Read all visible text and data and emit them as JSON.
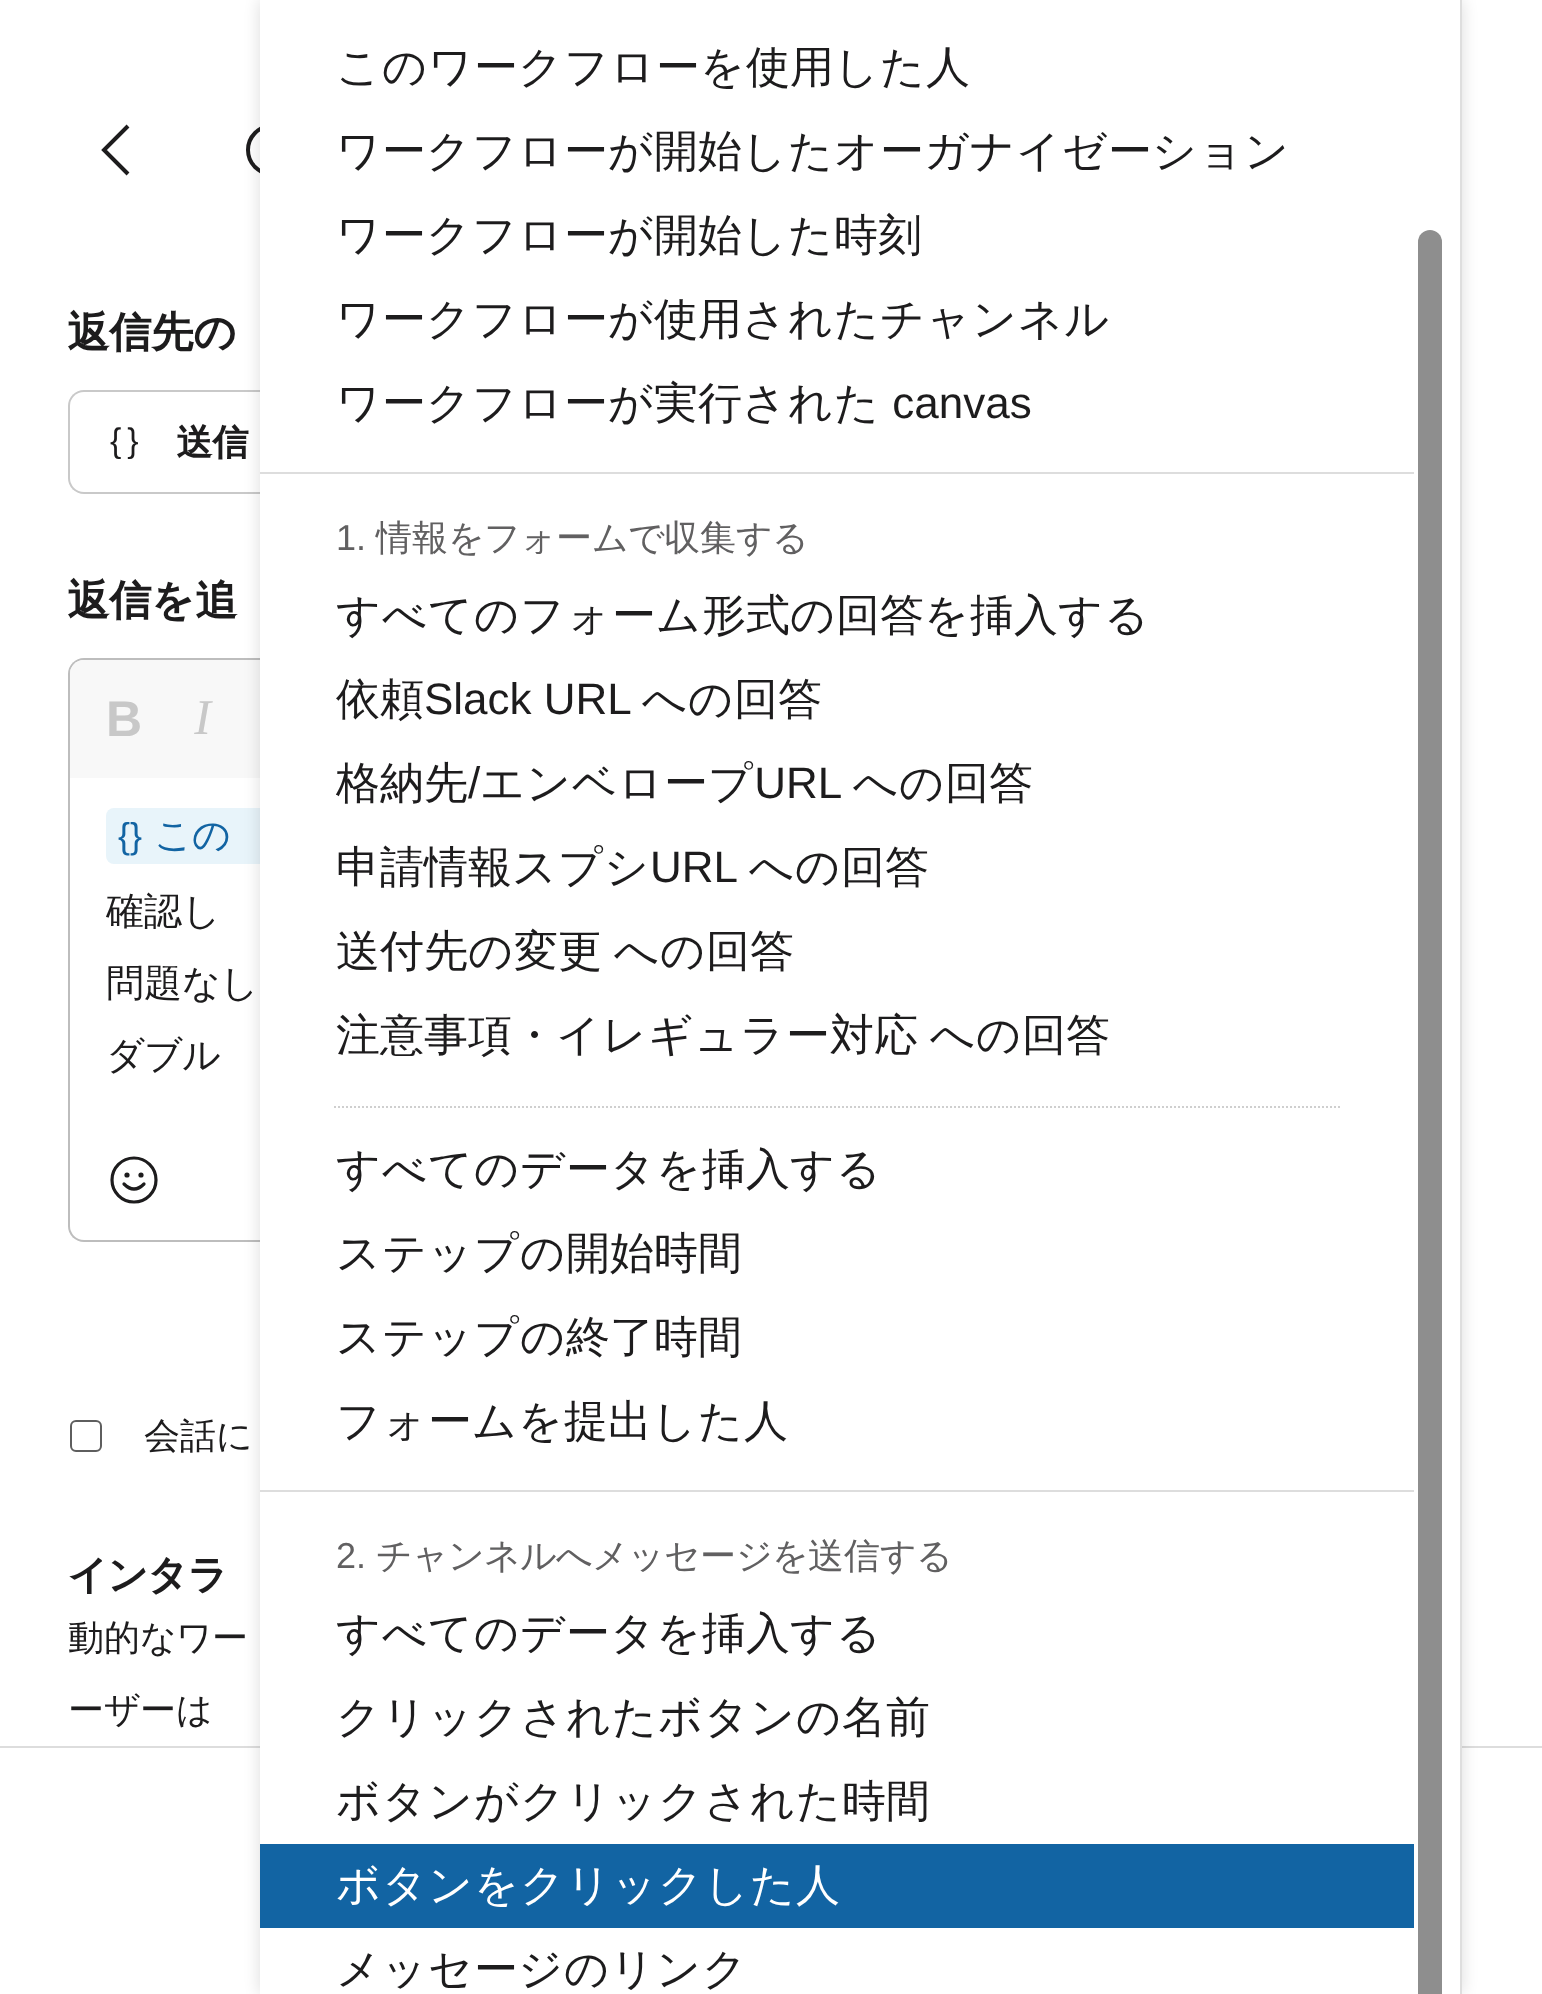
{
  "form": {
    "reply_to": {
      "label": "返信先の",
      "token_icon": "{}",
      "value": "送信"
    },
    "reply_message": {
      "label": "返信を追",
      "toolbar": [
        {
          "kind": "bold",
          "label": "B",
          "disabled": true
        },
        {
          "kind": "italic",
          "label": "I",
          "disabled": true
        }
      ],
      "variable": {
        "icon": "{}",
        "label": "この"
      },
      "lines": [
        "確認し",
        "問題なし",
        "ダブル"
      ]
    },
    "conversation_option": {
      "label": "会話に",
      "checked": false
    },
    "interactive_note": {
      "title": "インタラ",
      "lines": [
        "動的なワー",
        "ーザーは"
      ]
    }
  },
  "dropdown": {
    "sections": [
      {
        "groups": [
          {
            "items": [
              {
                "label": "このワークフローを使用した人",
                "selected": false
              },
              {
                "label": "ワークフローが開始したオーガナイゼーション",
                "selected": false
              },
              {
                "label": "ワークフローが開始した時刻",
                "selected": false
              },
              {
                "label": "ワークフローが使用されたチャンネル",
                "selected": false
              },
              {
                "label": "ワークフローが実行された canvas",
                "selected": false
              }
            ]
          }
        ]
      },
      {
        "header": "1. 情報をフォームで収集する",
        "groups": [
          {
            "items": [
              {
                "label": "すべてのフォーム形式の回答を挿入する",
                "selected": false
              },
              {
                "label": "依頼Slack URL への回答",
                "selected": false
              },
              {
                "label": "格納先/エンベロープURL への回答",
                "selected": false
              },
              {
                "label": "申請情報スプシURL への回答",
                "selected": false
              },
              {
                "label": "送付先の変更 への回答",
                "selected": false
              },
              {
                "label": "注意事項・イレギュラー対応 への回答",
                "selected": false
              }
            ]
          },
          {
            "items": [
              {
                "label": "すべてのデータを挿入する",
                "selected": false
              },
              {
                "label": "ステップの開始時間",
                "selected": false
              },
              {
                "label": "ステップの終了時間",
                "selected": false
              },
              {
                "label": "フォームを提出した人",
                "selected": false
              }
            ]
          }
        ]
      },
      {
        "header": "2. チャンネルへメッセージを送信する",
        "groups": [
          {
            "items": [
              {
                "label": "すべてのデータを挿入する",
                "selected": false
              },
              {
                "label": "クリックされたボタンの名前",
                "selected": false
              },
              {
                "label": "ボタンがクリックされた時間",
                "selected": false
              },
              {
                "label": "ボタンをクリックした人",
                "selected": true
              },
              {
                "label": "メッセージのリンク",
                "selected": false
              }
            ]
          }
        ]
      }
    ]
  }
}
